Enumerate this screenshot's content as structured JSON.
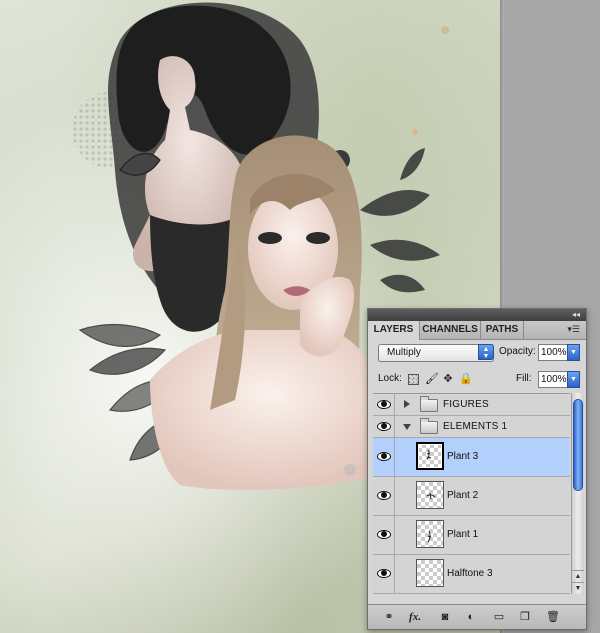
{
  "panel": {
    "tabs": [
      {
        "label": "LAYERS",
        "active": true
      },
      {
        "label": "CHANNELS",
        "active": false
      },
      {
        "label": "PATHS",
        "active": false
      }
    ],
    "blend_mode": "Multiply",
    "opacity_label": "Opacity:",
    "opacity_value": "100%",
    "lock_label": "Lock:",
    "fill_label": "Fill:",
    "fill_value": "100%",
    "layers": [
      {
        "name": "FIGURES",
        "type": "group",
        "expanded": false,
        "visible": true
      },
      {
        "name": "ELEMENTS 1",
        "type": "group",
        "expanded": true,
        "visible": true
      },
      {
        "name": "Plant 3",
        "type": "layer",
        "selected": true,
        "visible": true
      },
      {
        "name": "Plant 2",
        "type": "layer",
        "selected": false,
        "visible": true
      },
      {
        "name": "Plant 1",
        "type": "layer",
        "selected": false,
        "visible": true
      },
      {
        "name": "Halftone 3",
        "type": "layer",
        "selected": false,
        "visible": true
      }
    ],
    "lock_icons": [
      "lock-transparent-icon",
      "lock-image-brush-icon",
      "lock-position-move-icon",
      "lock-all-padlock-icon"
    ],
    "bottom_icons": [
      "link-layers-icon",
      "layer-style-fx-icon",
      "layer-mask-icon",
      "adjustment-layer-icon",
      "new-group-folder-icon",
      "new-layer-icon",
      "trash-icon"
    ],
    "fx_label": "fx."
  },
  "colors": {
    "selection": "#b3cffb",
    "aqua_blue": "#2b62c9",
    "panel_bg": "#d6d6d6"
  }
}
